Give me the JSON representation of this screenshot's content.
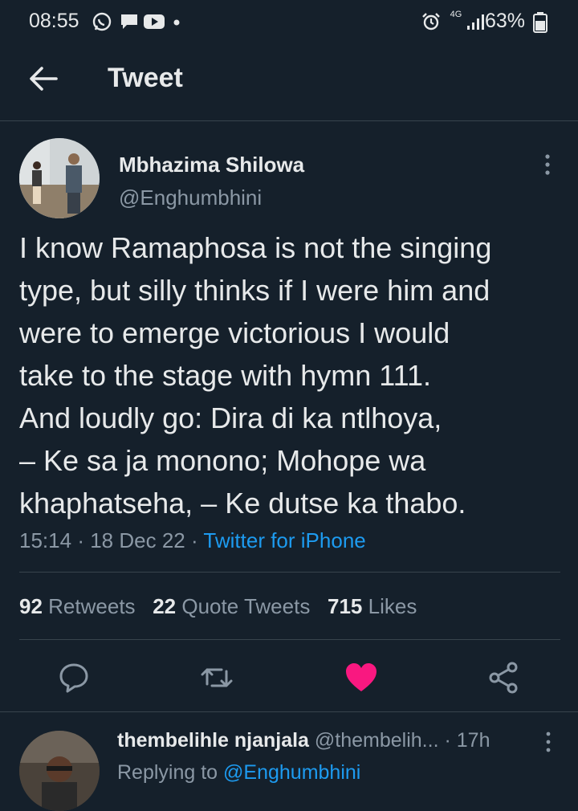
{
  "status_bar": {
    "time": "08:55",
    "battery": "63%",
    "network": "4G",
    "icons": [
      "whatsapp-icon",
      "chat-icon",
      "youtube-icon",
      "dot-icon",
      "alarm-icon",
      "signal-icon",
      "battery-icon"
    ]
  },
  "header": {
    "title": "Tweet",
    "back_icon": "arrow-left-icon"
  },
  "tweet": {
    "author_name": "Mbhazima Shilowa",
    "author_handle": "@Enghumbhini",
    "text": "I know Ramaphosa is not the singing\ntype, but silly thinks if I were him and\nwere to emerge victorious I would\ntake to the stage with hymn 111.\nAnd loudly go: Dira di ka ntlhoya,\n– Ke sa ja monono; Mohope wa\nkhaphatseha, – Ke dutse ka thabo.",
    "time": "15:14",
    "date": "18 Dec 22",
    "separator": "·",
    "source": "Twitter for iPhone",
    "retweets_count": "92",
    "retweets_label": "Retweets",
    "quotes_count": "22",
    "quotes_label": "Quote Tweets",
    "likes_count": "715",
    "likes_label": "Likes"
  },
  "actions": {
    "reply_icon": "reply-icon",
    "retweet_icon": "retweet-icon",
    "like_icon": "heart-icon",
    "like_color": "#f91880",
    "share_icon": "share-icon"
  },
  "reply": {
    "name": "thembelihle njanjala",
    "handle": "@thembelih...",
    "age": "17h",
    "replying_to_label": "Replying to",
    "replying_to_handle": "@Enghumbhini"
  },
  "colors": {
    "background": "#15202b",
    "accent": "#1d9bf0",
    "secondary_text": "#8b98a5",
    "divider": "#38444d"
  }
}
